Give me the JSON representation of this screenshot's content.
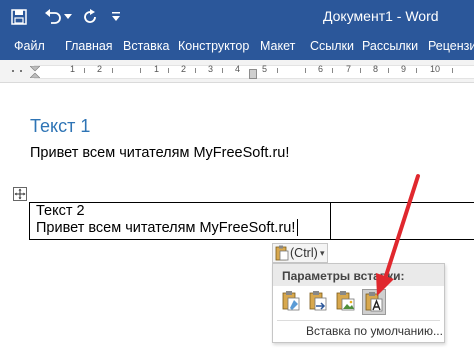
{
  "window": {
    "title": "Документ1  -  Word",
    "accent_color": "#2b579a"
  },
  "quick_access": [
    {
      "name": "save-icon"
    },
    {
      "name": "undo-icon"
    },
    {
      "name": "undo-dropdown-icon"
    },
    {
      "name": "redo-icon"
    },
    {
      "name": "customize-quick-access-icon"
    }
  ],
  "ribbon": {
    "tabs": [
      "Файл",
      "Главная",
      "Вставка",
      "Конструктор",
      "Макет",
      "Ссылки",
      "Рассылки",
      "Рецензи"
    ]
  },
  "ruler": {
    "numbers": [
      "1",
      "2",
      "1",
      "2",
      "3",
      "4",
      "5",
      "6",
      "7",
      "8",
      "9",
      "10"
    ]
  },
  "document": {
    "heading": "Текст 1",
    "paragraph": "Привет всем читателям MyFreeSoft.ru!",
    "table": {
      "cells": [
        [
          "Текст 2",
          ""
        ],
        [
          "Привет всем читателям MyFreeSoft.ru!",
          ""
        ]
      ]
    }
  },
  "paste_options": {
    "button_label": "(Ctrl)",
    "button_arrow": "▾",
    "menu_header": "Параметры вставки:",
    "icons": [
      "keep-source-formatting-icon",
      "merge-formatting-icon",
      "picture-icon",
      "keep-text-only-icon"
    ],
    "selected_index": 3,
    "default_label": "Вставка по умолчанию..."
  },
  "annotation": {
    "arrow_color": "#e0282e"
  }
}
